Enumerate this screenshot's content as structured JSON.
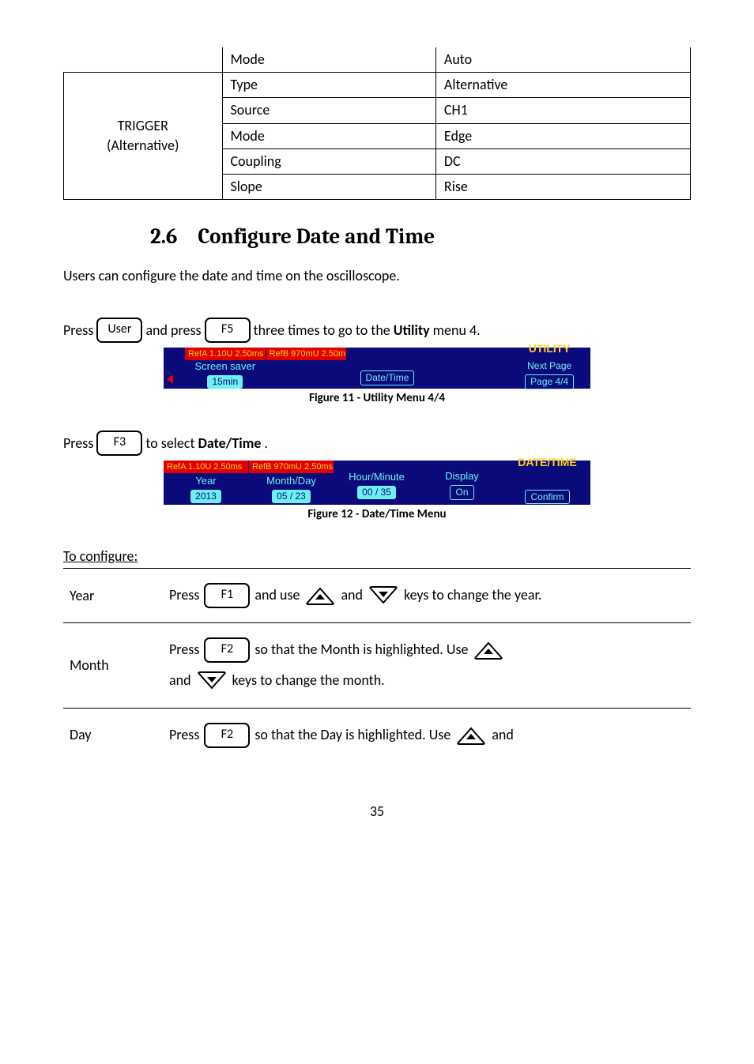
{
  "param_table": {
    "r0": {
      "c1": "Mode",
      "c2": "Auto"
    },
    "group_label": "TRIGGER\n(Alternative)",
    "rows": [
      {
        "c1": "Type",
        "c2": "Alternative"
      },
      {
        "c1": "Source",
        "c2": "CH1"
      },
      {
        "c1": "Mode",
        "c2": "Edge"
      },
      {
        "c1": "Coupling",
        "c2": "DC"
      },
      {
        "c1": "Slope",
        "c2": "Rise"
      }
    ]
  },
  "heading": {
    "num": "2.6",
    "title": "Configure Date and Time"
  },
  "intro": "Users can configure the date and time on the oscilloscope.",
  "instr1": {
    "pre": "Press",
    "key1": "User",
    "mid": " and press ",
    "key2": "F5",
    "post": " three times to go to the ",
    "bold": "Utility",
    "tail": " menu 4."
  },
  "utility_menu": {
    "head1": "RefA 1.10U 2.50ms",
    "head2": "RefB 970mU 2.50ms",
    "c1_top": "Screen saver",
    "c1_bot": "15min",
    "c3_bot": "Date/Time",
    "c5_title": "UTILITY",
    "c5_top": "Next Page",
    "c5_bot": "Page 4/4"
  },
  "fig11": "Figure 11 - Utility Menu 4/4",
  "instr2": {
    "pre": "Press",
    "key": "F3",
    "mid": " to select ",
    "bold": "Date/Time",
    "tail": "."
  },
  "datetime_menu": {
    "head1": "RefA 1.10U 2.50ms",
    "head2": "RefB 970mU 2.50ms",
    "c1_top": "Year",
    "c1_bot": "2013",
    "c2_top": "Month/Day",
    "c2_bot": "05 / 23",
    "c3_top": "Hour/Minute",
    "c3_bot": "00 / 35",
    "c4_top": "Display",
    "c4_bot": "On",
    "c5_title": "DATE/TIME",
    "c5_bot": "Confirm"
  },
  "fig12": "Figure 12 - Date/Time Menu",
  "config_heading": "To configure:",
  "config": {
    "year": {
      "label": "Year",
      "pre": "Press",
      "key": "F1",
      "mid1": " and use ",
      "mid2": " and ",
      "post": " keys to change the year."
    },
    "month": {
      "label": "Month",
      "pre": "Press",
      "key": "F2",
      "mid": " so that the Month is highlighted.  Use ",
      "line2a": "and ",
      "line2b": " keys to change the month."
    },
    "day": {
      "label": "Day",
      "pre": "Press",
      "key": "F2",
      "mid": " so that the Day is highlighted.  Use ",
      "tail": " and"
    }
  },
  "page_number": "35"
}
